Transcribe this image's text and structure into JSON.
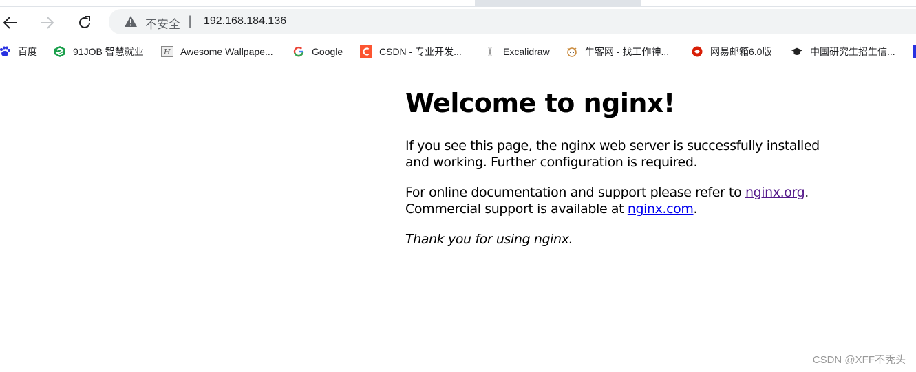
{
  "browser": {
    "security_label": "不安全",
    "separator": "|",
    "url": "192.168.184.136"
  },
  "bookmarks": [
    {
      "label": "百度",
      "icon": "baidu-paw-icon",
      "color": "#2932e1"
    },
    {
      "label": "91JOB 智慧就业",
      "icon": "91job-logo-icon",
      "color": "#1a9f4b"
    },
    {
      "label": "Awesome Wallpape...",
      "icon": "wallpaper-logo-icon",
      "color": "#888888"
    },
    {
      "label": "Google",
      "icon": "google-g-icon",
      "color": "#4285f4"
    },
    {
      "label": "CSDN - 专业开发...",
      "icon": "csdn-c-icon",
      "color": "#fc5531"
    },
    {
      "label": "Excalidraw",
      "icon": "excalidraw-icon",
      "color": "#6965db"
    },
    {
      "label": "牛客网 - 找工作神...",
      "icon": "nowcoder-icon",
      "color": "#25bb9b"
    },
    {
      "label": "网易邮箱6.0版",
      "icon": "netease-mail-icon",
      "color": "#d81e06"
    },
    {
      "label": "中国研究生招生信...",
      "icon": "graduation-cap-icon",
      "color": "#222222"
    }
  ],
  "page": {
    "heading": "Welcome to nginx!",
    "p1": "If you see this page, the nginx web server is successfully installed and working. Further configuration is required.",
    "p2_before": "For online documentation and support please refer to ",
    "p2_link1": "nginx.org",
    "p2_mid": ".",
    "p2_line2": "Commercial support is available at ",
    "p2_link2": "nginx.com",
    "p2_end": ".",
    "p3": "Thank you for using nginx."
  },
  "watermark": "CSDN @XFF不秃头"
}
